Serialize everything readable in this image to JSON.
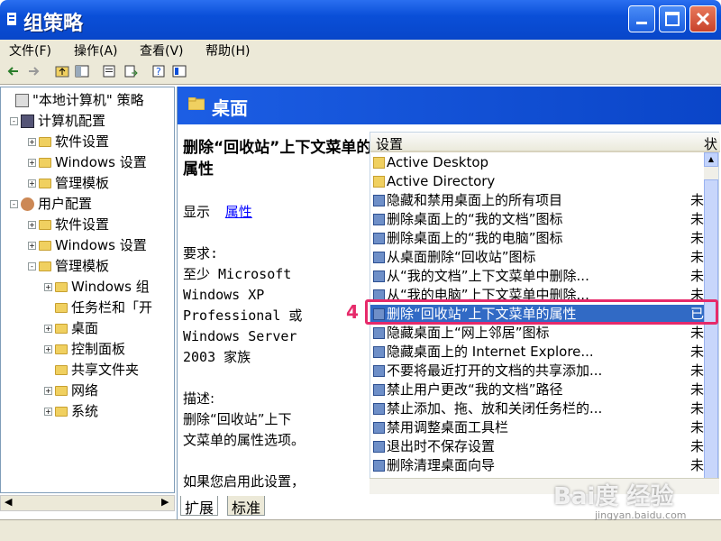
{
  "window": {
    "title": "组策略",
    "accent": "#0a4fd8"
  },
  "menu": [
    "文件(F)",
    "操作(A)",
    "查看(V)",
    "帮助(H)"
  ],
  "tree": [
    {
      "label": "\"本地计算机\" 策略",
      "exp": "",
      "icon": "policy"
    },
    {
      "label": "计算机配置",
      "exp": "-",
      "icon": "computer"
    },
    {
      "label": "软件设置",
      "exp": "+",
      "icon": "folder"
    },
    {
      "label": "Windows 设置",
      "exp": "+",
      "icon": "folder"
    },
    {
      "label": "管理模板",
      "exp": "+",
      "icon": "folder"
    },
    {
      "label": "用户配置",
      "exp": "-",
      "icon": "user"
    },
    {
      "label": "软件设置",
      "exp": "+",
      "icon": "folder"
    },
    {
      "label": "Windows 设置",
      "exp": "+",
      "icon": "folder"
    },
    {
      "label": "管理模板",
      "exp": "-",
      "icon": "folder"
    },
    {
      "label": "Windows 组",
      "exp": "+",
      "icon": "folder"
    },
    {
      "label": "任务栏和「开",
      "exp": "",
      "icon": "folder"
    },
    {
      "label": "桌面",
      "exp": "+",
      "icon": "folder-open"
    },
    {
      "label": "控制面板",
      "exp": "+",
      "icon": "folder"
    },
    {
      "label": "共享文件夹",
      "exp": "",
      "icon": "folder"
    },
    {
      "label": "网络",
      "exp": "+",
      "icon": "folder"
    },
    {
      "label": "系统",
      "exp": "+",
      "icon": "folder"
    }
  ],
  "pane": {
    "title": "桌面"
  },
  "desc": {
    "title": "删除“回收站”上下文菜单的属性",
    "show_label": "显示",
    "props_link": "属性",
    "req_label": "要求:",
    "req_lines": [
      "至少 Microsoft",
      "Windows XP",
      "Professional 或",
      "Windows Server",
      "2003 家族"
    ],
    "desc_label": "描述:",
    "desc_lines": [
      "删除“回收站”上下",
      "文菜单的属性选项。"
    ],
    "extra": "如果您启用此设置，"
  },
  "list": {
    "col_setting": "设置",
    "col_state": "状",
    "rows": [
      {
        "text": "Active Desktop",
        "state": "",
        "icon": "folder"
      },
      {
        "text": "Active Directory",
        "state": "",
        "icon": "folder"
      },
      {
        "text": "隐藏和禁用桌面上的所有项目",
        "state": "未很",
        "icon": "setting"
      },
      {
        "text": "删除桌面上的“我的文档”图标",
        "state": "未很",
        "icon": "setting"
      },
      {
        "text": "删除桌面上的“我的电脑”图标",
        "state": "未很",
        "icon": "setting"
      },
      {
        "text": "从桌面删除“回收站”图标",
        "state": "未很",
        "icon": "setting"
      },
      {
        "text": "从“我的文档”上下文菜单中删除...",
        "state": "未很",
        "icon": "setting"
      },
      {
        "text": "从“我的电脑”上下文菜单中删除...",
        "state": "未很",
        "icon": "setting"
      },
      {
        "text": "删除“回收站”上下文菜单的属性",
        "state": "已",
        "icon": "setting",
        "selected": true
      },
      {
        "text": "隐藏桌面上“网上邻居”图标",
        "state": "未很",
        "icon": "setting"
      },
      {
        "text": "隐藏桌面上的 Internet Explore...",
        "state": "未很",
        "icon": "setting"
      },
      {
        "text": "不要将最近打开的文档的共享添加...",
        "state": "未很",
        "icon": "setting"
      },
      {
        "text": "禁止用户更改“我的文档”路径",
        "state": "未很",
        "icon": "setting"
      },
      {
        "text": "禁止添加、拖、放和关闭任务栏的...",
        "state": "未很",
        "icon": "setting"
      },
      {
        "text": "禁用调整桌面工具栏",
        "state": "未很",
        "icon": "setting"
      },
      {
        "text": "退出时不保存设置",
        "state": "未很",
        "icon": "setting"
      },
      {
        "text": "删除清理桌面向导",
        "state": "未很",
        "icon": "setting"
      }
    ]
  },
  "tabs": [
    "扩展",
    "标准"
  ],
  "annotation": {
    "step": "4",
    "color": "#e62a6a"
  },
  "watermark": {
    "brand": "Bai度 经验",
    "url": "jingyan.baidu.com"
  }
}
